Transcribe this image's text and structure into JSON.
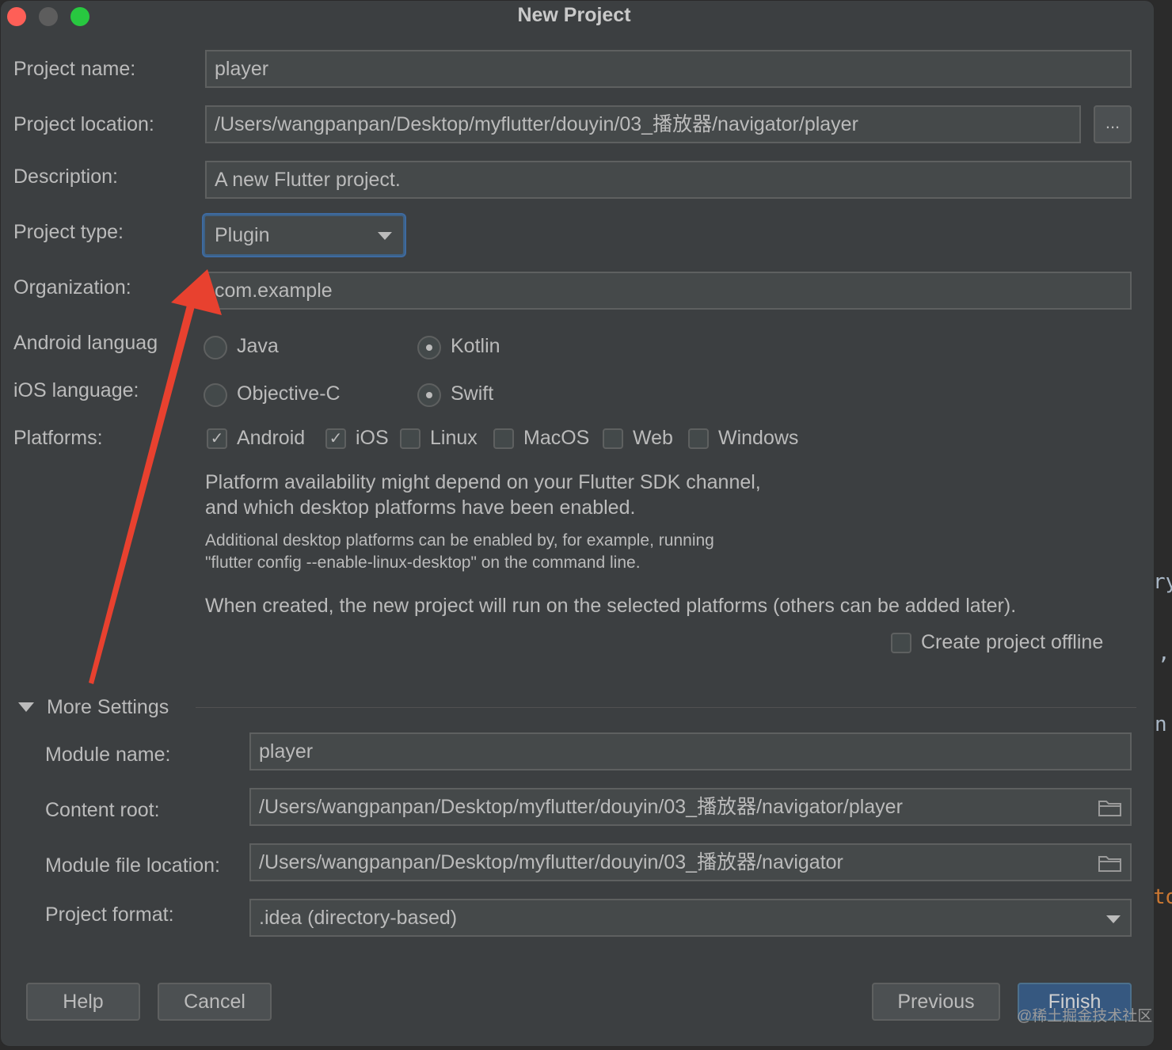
{
  "window": {
    "title": "New Project"
  },
  "form": {
    "project_name": {
      "label": "Project name:",
      "value": "player"
    },
    "project_location": {
      "label": "Project location:",
      "value": "/Users/wangpanpan/Desktop/myflutter/douyin/03_播放器/navigator/player",
      "browse": "..."
    },
    "description": {
      "label": "Description:",
      "value": "A new Flutter project."
    },
    "project_type": {
      "label": "Project type:",
      "value": "Plugin"
    },
    "organization": {
      "label": "Organization:",
      "value": "com.example"
    },
    "android_language": {
      "label": "Android languag",
      "options": [
        "Java",
        "Kotlin"
      ],
      "selected": "Kotlin"
    },
    "ios_language": {
      "label": "iOS language:",
      "options": [
        "Objective-C",
        "Swift"
      ],
      "selected": "Swift"
    },
    "platforms": {
      "label": "Platforms:",
      "items": [
        {
          "label": "Android",
          "checked": true
        },
        {
          "label": "iOS",
          "checked": true
        },
        {
          "label": "Linux",
          "checked": false
        },
        {
          "label": "MacOS",
          "checked": false
        },
        {
          "label": "Web",
          "checked": false
        },
        {
          "label": "Windows",
          "checked": false
        }
      ]
    },
    "notes": {
      "availability_1": "Platform availability might depend on your Flutter SDK channel,",
      "availability_2": "and which desktop platforms have been enabled.",
      "desktop_1": "Additional desktop platforms can be enabled by, for example, running",
      "desktop_2": "\"flutter config --enable-linux-desktop\" on the command line.",
      "when_created": "When created, the new project will run on the selected platforms (others can be added later)."
    },
    "create_offline": {
      "label": "Create project offline",
      "checked": false
    }
  },
  "more_settings": {
    "header": "More Settings",
    "module_name": {
      "label": "Module name:",
      "value": "player"
    },
    "content_root": {
      "label": "Content root:",
      "value": "/Users/wangpanpan/Desktop/myflutter/douyin/03_播放器/navigator/player"
    },
    "module_file_location": {
      "label": "Module file location:",
      "value": "/Users/wangpanpan/Desktop/myflutter/douyin/03_播放器/navigator"
    },
    "project_format": {
      "label": "Project format:",
      "value": ".idea (directory-based)"
    }
  },
  "buttons": {
    "help": "Help",
    "cancel": "Cancel",
    "previous": "Previous",
    "finish": "Finish"
  },
  "watermark": "@稀土掘金技术社区",
  "background_text": {
    "t1": "ry",
    "t2": ",",
    "t3": "n",
    "t4": "to"
  },
  "colors": {
    "annotation_arrow": "#e8412f",
    "accent": "#365880",
    "background": "#3c3f41"
  }
}
